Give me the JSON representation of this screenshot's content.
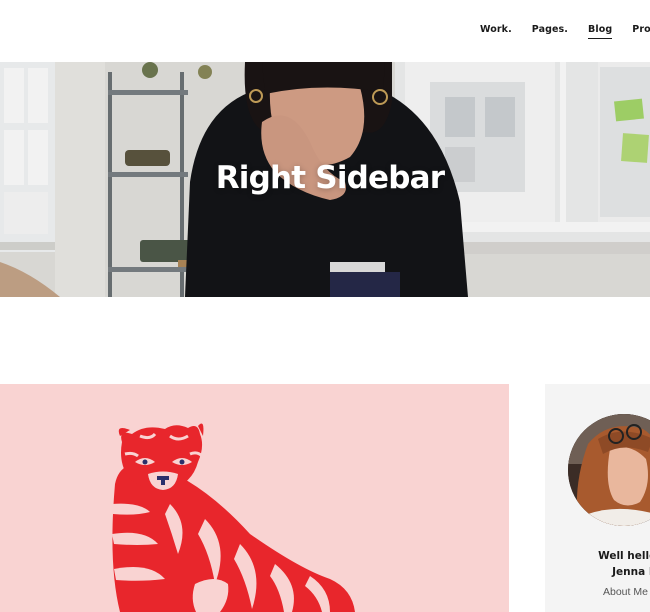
{
  "nav": {
    "items": [
      {
        "label": "Work.",
        "active": false
      },
      {
        "label": "Pages.",
        "active": false
      },
      {
        "label": "Blog",
        "active": true
      },
      {
        "label": "Products",
        "active": false
      }
    ]
  },
  "hero": {
    "title": "Right Sidebar"
  },
  "sidebar": {
    "greeting_line1": "Well hello there",
    "greeting_line2": "Jenna Palm",
    "about_label": "About Me"
  },
  "colors": {
    "post_card_bg": "#f9d3d2",
    "tiger_red": "#e8262c",
    "sidebar_bg": "#f4f4f4"
  }
}
